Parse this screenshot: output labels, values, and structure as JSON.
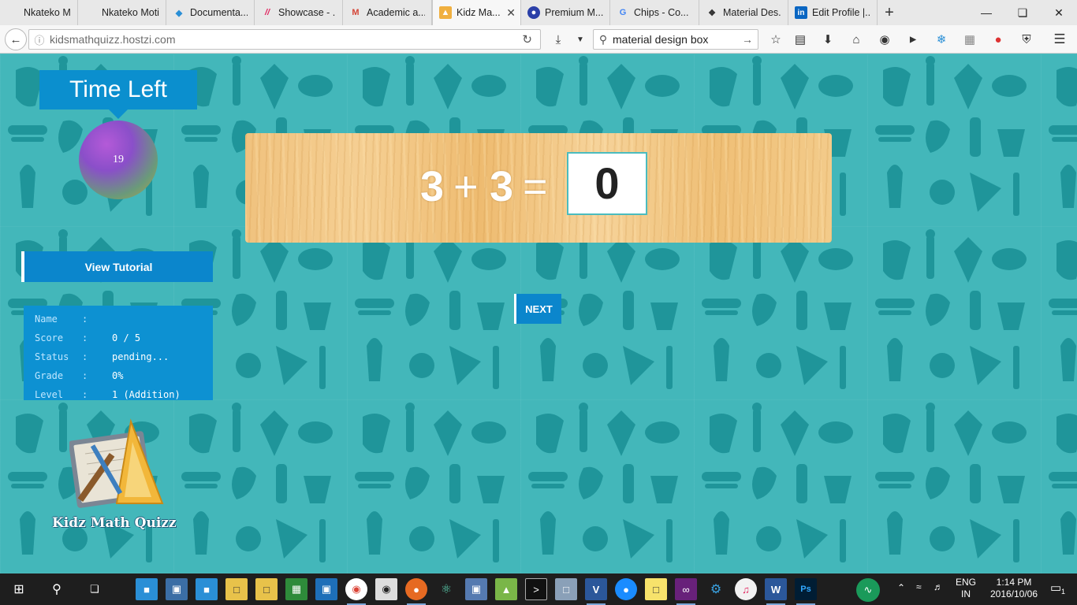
{
  "browser": {
    "tabs": [
      {
        "label": "Nkateko Motileng",
        "icon": "blank-page-icon",
        "color": "#e8e8e8"
      },
      {
        "label": "Nkateko Motileng",
        "icon": "blank-page-icon",
        "color": "#e8e8e8"
      },
      {
        "label": "Documenta...",
        "icon": "diamond-icon",
        "color": "#2a8fd6"
      },
      {
        "label": "Showcase - ...",
        "icon": "slashes-icon",
        "color": "#e0245e"
      },
      {
        "label": "Academic a...",
        "icon": "gmail-icon",
        "color": "#d44638"
      },
      {
        "label": "Kidz Ma...",
        "icon": "math-app-icon",
        "color": "#f0b040",
        "active": true
      },
      {
        "label": "Premium M...",
        "icon": "premium-icon",
        "color": "#2a3fa8"
      },
      {
        "label": "Chips - Co...",
        "icon": "google-icon",
        "color": "#4285f4"
      },
      {
        "label": "Material Des...",
        "icon": "material-icon",
        "color": "#333333"
      },
      {
        "label": "Edit Profile |...",
        "icon": "linkedin-icon",
        "color": "#0a66c2"
      }
    ],
    "new_tab_symbol": "+",
    "address": {
      "host": "kidsmathquizz",
      "domain": ".hostzi.com"
    },
    "search_text": "material design box"
  },
  "quiz": {
    "time_left_label": "Time Left",
    "timer_value": "19",
    "equation": {
      "a": "3",
      "op": "+",
      "b": "3",
      "eq": "="
    },
    "answer": "0",
    "view_tutorial_label": "View Tutorial",
    "next_label": "NEXT",
    "info": [
      {
        "label": "Name",
        "value": ""
      },
      {
        "label": "Score",
        "value": "0 / 5"
      },
      {
        "label": "Status",
        "value": "pending..."
      },
      {
        "label": "Grade",
        "value": "0%"
      },
      {
        "label": "Level",
        "value": "1 (Addition)"
      }
    ],
    "logo_title": "Kidz Math Quizz"
  },
  "taskbar": {
    "lang": "ENG",
    "region": "IN",
    "time": "1:14 PM",
    "date": "2016/10/06",
    "notifications": "1"
  },
  "colors": {
    "accent": "#0b8fce",
    "page_bg": "#43b7ba",
    "pattern": "#1a8d92"
  }
}
